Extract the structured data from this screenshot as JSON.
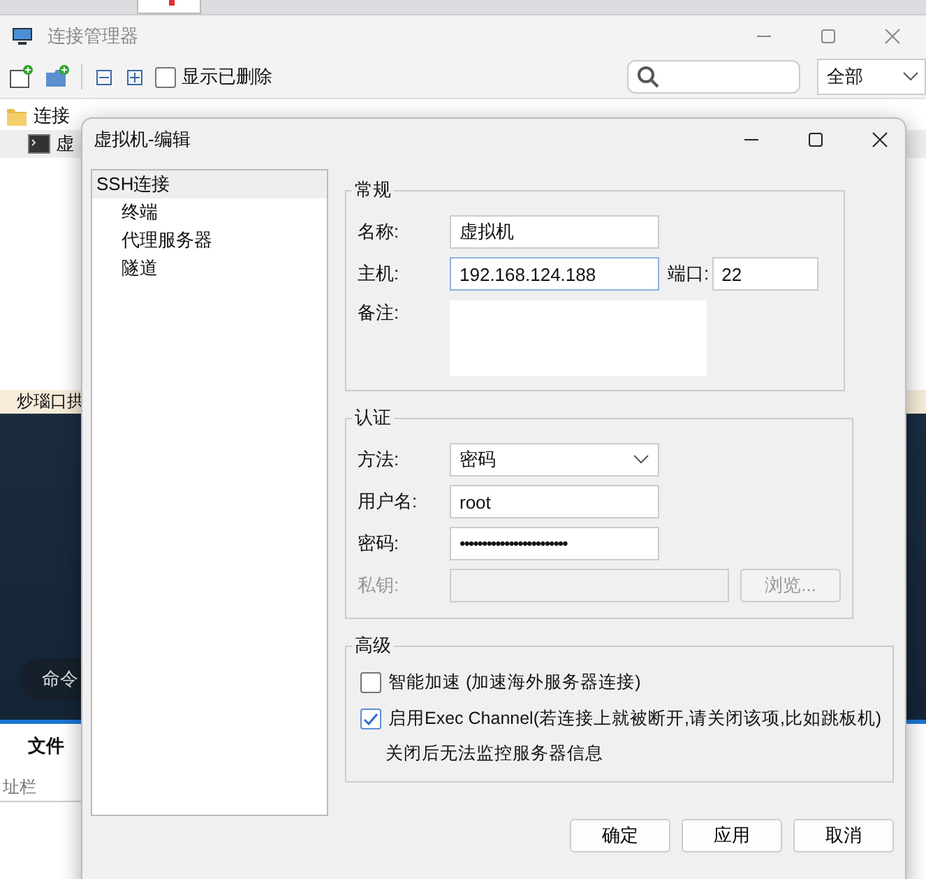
{
  "app": {
    "banner": "炒瑙口拱",
    "command_button": "命令",
    "tabs": [
      {
        "label": "文件",
        "selected": true
      }
    ],
    "address": {
      "placeholder": "址栏"
    }
  },
  "manager": {
    "title": "连接管理器",
    "show_deleted": {
      "label": "显示已删除",
      "checked": false
    },
    "filter": {
      "value": "全部"
    },
    "tree": [
      {
        "label": "连接",
        "children": [
          {
            "label": "虚"
          }
        ]
      }
    ]
  },
  "dialog": {
    "title": "虚拟机-编辑",
    "nav": [
      {
        "label": "SSH连接",
        "selected": true,
        "children": [
          {
            "label": "终端",
            "selected": false
          },
          {
            "label": "代理服务器",
            "selected": false
          },
          {
            "label": "隧道",
            "selected": false
          }
        ]
      }
    ],
    "general": {
      "title": "常规",
      "name": {
        "label": "名称:",
        "value": "虚拟机"
      },
      "host": {
        "label": "主机:",
        "value": "192.168.124.188",
        "focused": true
      },
      "port": {
        "label": "端口:",
        "value": "22"
      },
      "note": {
        "label": "备注:"
      }
    },
    "auth": {
      "title": "认证",
      "method": {
        "label": "方法:",
        "value": "密码"
      },
      "user": {
        "label": "用户名:",
        "value": "root"
      },
      "password": {
        "label": "密码:",
        "value": "••••••••••••••••••••••••"
      },
      "key": {
        "label": "私钥:",
        "disabled": true
      },
      "browse": {
        "label": "浏览...",
        "disabled": true
      }
    },
    "advanced": {
      "title": "高级",
      "options": [
        {
          "label": "智能加速 (加速海外服务器连接)",
          "checked": false
        },
        {
          "label": "启用Exec Channel(若连接上就被断开,请关闭该项,比如跳板机)",
          "checked": true,
          "note": "关闭后无法监控服务器信息"
        }
      ]
    },
    "buttons": [
      "确定",
      "应用",
      "取消"
    ]
  }
}
